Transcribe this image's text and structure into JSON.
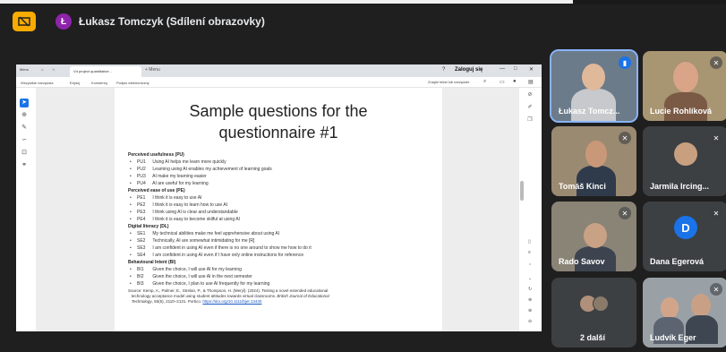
{
  "header": {
    "presenter_initial": "Ł",
    "presenter_title": "Łukasz Tomczyk (Sdílení obrazovky)"
  },
  "browser": {
    "tab_left": "Menu",
    "tab_title": "Vd project quantitative...",
    "tab_new": "+ Menu",
    "signin": "Zaloguj się",
    "menu": [
      "Wszystkie narzędzia",
      "Edytuj",
      "Konwertuj",
      "Podpis elektroniczny"
    ],
    "search": "Znajdź tekst lub narzędzie"
  },
  "slide": {
    "title_line1": "Sample questions for the",
    "title_line2": "questionnaire #1",
    "sections": [
      {
        "heading": "Perceived usefulness (PU)",
        "items": [
          {
            "code": "PU1",
            "text": "Using AI helps me learn more quickly"
          },
          {
            "code": "PU2",
            "text": "Learning using AI enables my achievement of learning goals"
          },
          {
            "code": "PU3",
            "text": "AI make my learning easier"
          },
          {
            "code": "PU4",
            "text": "AI are useful for my learning"
          }
        ]
      },
      {
        "heading": "Perceived ease of use (PE)",
        "items": [
          {
            "code": "PE1",
            "text": "I think it is easy to use AI"
          },
          {
            "code": "PE2",
            "text": "I think it is easy to learn how to use AI"
          },
          {
            "code": "PE3",
            "text": "I think using AI is clear and understandable"
          },
          {
            "code": "PE4",
            "text": "I think it is easy to become skilful at using AI"
          }
        ]
      },
      {
        "heading": "Digital literacy (DL)",
        "items": [
          {
            "code": "SE1",
            "text": "My technical abilities make me feel apprehensive about using AI"
          },
          {
            "code": "SE2",
            "text": "Technically, AI are somewhat intimidating for me [R]"
          },
          {
            "code": "SE3",
            "text": "I am confident in using AI even if there is no one around to show me how to do it"
          },
          {
            "code": "SE4",
            "text": "I am confident in using AI even if I have only online instructions for reference"
          }
        ]
      },
      {
        "heading": "Behavioural Intent (BI)",
        "items": [
          {
            "code": "BI1",
            "text": "Given the choice, I will use AI for my learning"
          },
          {
            "code": "BI2",
            "text": "Given the choice, I will use AI in the next semester"
          },
          {
            "code": "BI3",
            "text": "Given the choice, I plan to use AI frequently for my learning"
          }
        ]
      }
    ],
    "source_line1": "Source: Kemp, A., Palmer, E., Strelan, P., & Thompson, H. (Meryl). (2024). Testing a novel extended educational",
    "source_line2": "technology acceptance model using student attitudes towards virtual classrooms.",
    "source_journal": "British Journal of Educational",
    "source_line3": "Technology",
    "source_line3b": ", 55(5), 2110–2131. Portico.",
    "source_link": "https://doi.org/10.1111/bjet.13440"
  },
  "participants": [
    {
      "name": "Łukasz Tomcz...",
      "active": true
    },
    {
      "name": "Lucie Rohlíková"
    },
    {
      "name": "Tomáš Kinci"
    },
    {
      "name": "Jarmila Ircing..."
    },
    {
      "name": "Rado Savov"
    },
    {
      "name": "Dana Egerová",
      "initial": "D"
    },
    {
      "name": "2 další"
    },
    {
      "name": "Ludvík Eger"
    }
  ],
  "colors": {
    "accent_present": "#f9ab00",
    "presenter_avatar": "#8e24aa",
    "dana_avatar": "#1a73e8",
    "active_outline": "#8ab4f8"
  }
}
